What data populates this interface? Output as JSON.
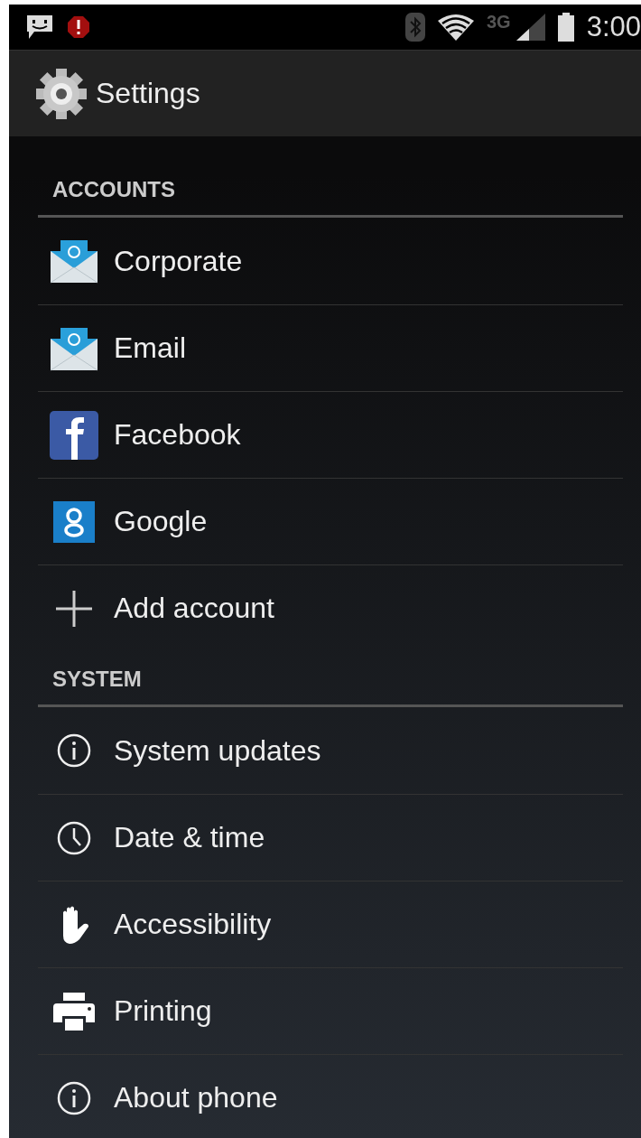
{
  "status_bar": {
    "network": "3G",
    "time": "3:00"
  },
  "action_bar": {
    "title": "Settings"
  },
  "sections": [
    {
      "title": "ACCOUNTS",
      "items": [
        {
          "label": "Corporate",
          "kind": "mail"
        },
        {
          "label": "Email",
          "kind": "mail"
        },
        {
          "label": "Facebook",
          "kind": "facebook"
        },
        {
          "label": "Google",
          "kind": "google"
        },
        {
          "label": "Add account",
          "kind": "plus"
        }
      ]
    },
    {
      "title": "SYSTEM",
      "items": [
        {
          "label": "System updates",
          "kind": "info"
        },
        {
          "label": "Date & time",
          "kind": "clock"
        },
        {
          "label": "Accessibility",
          "kind": "hand"
        },
        {
          "label": "Printing",
          "kind": "printer"
        },
        {
          "label": "About phone",
          "kind": "info"
        }
      ]
    }
  ]
}
